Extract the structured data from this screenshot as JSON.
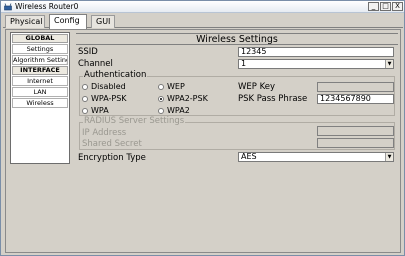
{
  "window": {
    "title": "Wireless Router0",
    "min_glyph": "_",
    "max_glyph": "□",
    "close_glyph": "X"
  },
  "tabs": [
    {
      "label": "Physical",
      "active": false
    },
    {
      "label": "Config",
      "active": true
    },
    {
      "label": "GUI",
      "active": false
    }
  ],
  "nav": {
    "global_header": "GLOBAL",
    "global_items": [
      "Settings",
      "Algorithm Settings"
    ],
    "interface_header": "INTERFACE",
    "interface_items": [
      "Internet",
      "LAN",
      "Wireless"
    ]
  },
  "wireless": {
    "heading": "Wireless Settings",
    "ssid_label": "SSID",
    "ssid_value": "12345",
    "channel_label": "Channel",
    "channel_value": "1",
    "auth_title": "Authentication",
    "auth_options": {
      "disabled": "Disabled",
      "wep": "WEP",
      "wpa_psk": "WPA-PSK",
      "wpa2_psk": "WPA2-PSK",
      "wpa": "WPA",
      "wpa2": "WPA2"
    },
    "selected_auth": "wpa2_psk",
    "wep_key_label": "WEP Key",
    "wep_key_value": "",
    "psk_label": "PSK Pass Phrase",
    "psk_value": "1234567890",
    "radius_title": "RADIUS Server Settings",
    "ip_label": "IP Address",
    "ip_value": "",
    "secret_label": "Shared Secret",
    "secret_value": "",
    "encryption_label": "Encryption Type",
    "encryption_value": "AES"
  },
  "colors": {
    "window_bg": "#d4d0c8",
    "disabled_text": "#9a9890"
  }
}
